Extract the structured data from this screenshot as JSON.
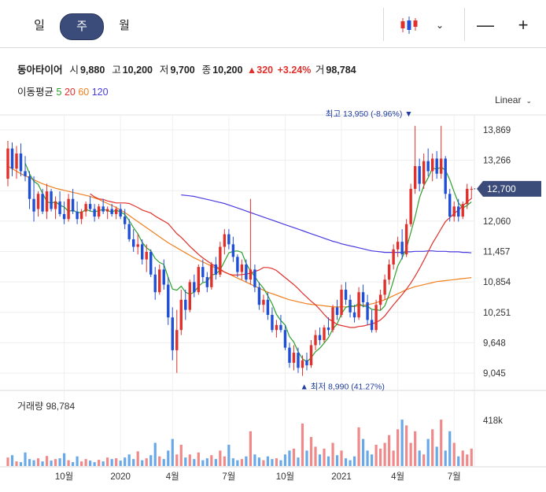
{
  "periods": [
    {
      "label": "일",
      "active": false
    },
    {
      "label": "주",
      "active": true
    },
    {
      "label": "월",
      "active": false
    }
  ],
  "toolbar": {
    "chart_style_icon": "candlestick-icon",
    "dropdown_icon": "chevron-down-icon",
    "zoom_out_icon": "minus-icon",
    "zoom_in_icon": "plus-icon",
    "zoom_out_glyph": "—",
    "zoom_in_glyph": "+"
  },
  "quote": {
    "name": "동아타이어",
    "open_label": "시",
    "open": "9,880",
    "high_label": "고",
    "high": "10,200",
    "low_label": "저",
    "low": "9,700",
    "close_label": "종",
    "close": "10,200",
    "change": "▲320",
    "change_pct": "+3.24%",
    "volume_label": "거",
    "volume": "98,784"
  },
  "moving_average": {
    "label": "이동평균",
    "periods": [
      {
        "value": "5",
        "color": "#2ca02c"
      },
      {
        "value": "20",
        "color": "#e0302c"
      },
      {
        "value": "60",
        "color": "#f07f1e"
      },
      {
        "value": "120",
        "color": "#4a3be0"
      }
    ]
  },
  "scale_button": "Linear",
  "price_panel": {
    "y_ticks": [
      "13,869",
      "13,266",
      "12,663",
      "12,060",
      "11,457",
      "10,854",
      "10,251",
      "9,648",
      "9,045"
    ],
    "current_price": "12,700",
    "high_annotation": "최고 13,950 (-8.96%)",
    "low_annotation": "최저 8,990 (41.27%)"
  },
  "volume_panel": {
    "label": "거래량 98,784",
    "y_tick": "418k"
  },
  "x_ticks": [
    "10월",
    "2020",
    "4월",
    "7월",
    "10월",
    "2021",
    "4월",
    "7월"
  ],
  "colors": {
    "up": "#e0302c",
    "down": "#1f4fd6",
    "vol_up": "#f08a8a",
    "vol_down": "#6aa9e8",
    "ma5": "#2ca02c",
    "ma20": "#e0302c",
    "ma60": "#f07f1e",
    "ma120": "#4a3be0",
    "badge": "#3b4c7b"
  },
  "chart_data": {
    "type": "candlestick",
    "ylim": [
      9045,
      13869
    ],
    "x_ticks": [
      {
        "label": "10월",
        "index": 13
      },
      {
        "label": "2020",
        "index": 26
      },
      {
        "label": "4월",
        "index": 38
      },
      {
        "label": "7월",
        "index": 51
      },
      {
        "label": "10월",
        "index": 64
      },
      {
        "label": "2021",
        "index": 77
      },
      {
        "label": "4월",
        "index": 90
      },
      {
        "label": "7월",
        "index": 103
      }
    ],
    "ohlc": [
      [
        12900,
        13650,
        12750,
        13500
      ],
      [
        13500,
        13620,
        12950,
        13100
      ],
      [
        13100,
        13550,
        12900,
        13400
      ],
      [
        13400,
        13600,
        12950,
        13050
      ],
      [
        13050,
        13350,
        12850,
        12950
      ],
      [
        12950,
        13050,
        12300,
        12500
      ],
      [
        12500,
        12950,
        12050,
        12250
      ],
      [
        12300,
        12650,
        12150,
        12600
      ],
      [
        12600,
        12700,
        12200,
        12250
      ],
      [
        12250,
        12800,
        12100,
        12650
      ],
      [
        12650,
        12700,
        12250,
        12300
      ],
      [
        12300,
        12550,
        12100,
        12450
      ],
      [
        12450,
        12650,
        12150,
        12200
      ],
      [
        12200,
        12450,
        12000,
        12100
      ],
      [
        12100,
        12600,
        12050,
        12500
      ],
      [
        12500,
        12700,
        12200,
        12250
      ],
      [
        12250,
        12450,
        12000,
        12100
      ],
      [
        12100,
        12300,
        12000,
        12250
      ],
      [
        12250,
        12450,
        12150,
        12400
      ],
      [
        12400,
        12550,
        12250,
        12300
      ],
      [
        12300,
        12400,
        12050,
        12150
      ],
      [
        12150,
        12400,
        12100,
        12350
      ],
      [
        12350,
        12500,
        12200,
        12250
      ],
      [
        12250,
        12350,
        12100,
        12300
      ],
      [
        12300,
        12400,
        12150,
        12200
      ],
      [
        12200,
        12350,
        12100,
        12300
      ],
      [
        12300,
        12400,
        12100,
        12150
      ],
      [
        12150,
        12300,
        11900,
        12000
      ],
      [
        12000,
        12100,
        11650,
        11700
      ],
      [
        11700,
        11900,
        11450,
        11550
      ],
      [
        11550,
        11800,
        11400,
        11600
      ],
      [
        11600,
        11700,
        11200,
        11300
      ],
      [
        11300,
        11600,
        11050,
        11450
      ],
      [
        11450,
        11500,
        10950,
        11000
      ],
      [
        11000,
        11150,
        10500,
        10650
      ],
      [
        10650,
        11200,
        10600,
        11100
      ],
      [
        11100,
        11300,
        10700,
        10800
      ],
      [
        10800,
        10950,
        10000,
        10150
      ],
      [
        10150,
        10350,
        9300,
        9500
      ],
      [
        9500,
        10300,
        9050,
        9900
      ],
      [
        9900,
        10700,
        9800,
        10500
      ],
      [
        10500,
        10700,
        10100,
        10300
      ],
      [
        10300,
        10900,
        10250,
        10850
      ],
      [
        10850,
        11000,
        10550,
        10650
      ],
      [
        10650,
        11200,
        10600,
        11150
      ],
      [
        11150,
        11300,
        10850,
        10950
      ],
      [
        10950,
        11050,
        10650,
        10750
      ],
      [
        10750,
        11250,
        10700,
        11200
      ],
      [
        11200,
        11350,
        10900,
        11000
      ],
      [
        11000,
        11650,
        10950,
        11550
      ],
      [
        11550,
        11900,
        11400,
        11800
      ],
      [
        11800,
        11900,
        11500,
        11600
      ],
      [
        11600,
        11750,
        11250,
        11350
      ],
      [
        11350,
        11400,
        10950,
        11050
      ],
      [
        11050,
        11300,
        10900,
        11200
      ],
      [
        11200,
        11300,
        10850,
        10900
      ],
      [
        10900,
        12500,
        10800,
        11100
      ],
      [
        11100,
        11200,
        10650,
        10750
      ],
      [
        10750,
        10850,
        10300,
        10400
      ],
      [
        10400,
        10600,
        10250,
        10500
      ],
      [
        10500,
        10650,
        10100,
        10200
      ],
      [
        10200,
        10350,
        9850,
        9900
      ],
      [
        9900,
        10100,
        9750,
        10000
      ],
      [
        10000,
        10200,
        9850,
        9900
      ],
      [
        9900,
        10000,
        9500,
        9550
      ],
      [
        9550,
        9650,
        9150,
        9250
      ],
      [
        9250,
        9600,
        9100,
        9450
      ],
      [
        9450,
        9550,
        9050,
        9150
      ],
      [
        9150,
        9400,
        8990,
        9300
      ],
      [
        9300,
        9450,
        9100,
        9200
      ],
      [
        9200,
        9700,
        9150,
        9600
      ],
      [
        9600,
        9900,
        9500,
        9800
      ],
      [
        9800,
        9950,
        9600,
        9700
      ],
      [
        9700,
        10000,
        9650,
        9950
      ],
      [
        9950,
        10150,
        9800,
        9900
      ],
      [
        9900,
        10400,
        9850,
        10350
      ],
      [
        10350,
        10500,
        10100,
        10200
      ],
      [
        10200,
        10800,
        10150,
        10700
      ],
      [
        10700,
        10850,
        10400,
        10500
      ],
      [
        10500,
        10600,
        10150,
        10250
      ],
      [
        10250,
        10400,
        10050,
        10150
      ],
      [
        10150,
        10750,
        10100,
        10650
      ],
      [
        10650,
        10800,
        10350,
        10450
      ],
      [
        10450,
        10600,
        10000,
        10100
      ],
      [
        10100,
        10300,
        9850,
        9900
      ],
      [
        9900,
        10500,
        9850,
        10400
      ],
      [
        10400,
        10700,
        10300,
        10600
      ],
      [
        10600,
        11000,
        10500,
        10900
      ],
      [
        10900,
        11300,
        10800,
        11200
      ],
      [
        11200,
        11600,
        11100,
        11500
      ],
      [
        11500,
        11750,
        11350,
        11650
      ],
      [
        11650,
        11900,
        11300,
        11400
      ],
      [
        11400,
        12100,
        11350,
        12000
      ],
      [
        12000,
        12800,
        11950,
        12700
      ],
      [
        12700,
        13950,
        12600,
        13150
      ],
      [
        13150,
        13300,
        12650,
        12800
      ],
      [
        12800,
        13400,
        12700,
        13250
      ],
      [
        13250,
        13500,
        12950,
        13050
      ],
      [
        13050,
        13400,
        12850,
        13300
      ],
      [
        13300,
        13450,
        12900,
        13000
      ],
      [
        13000,
        13950,
        12900,
        13300
      ],
      [
        13300,
        13350,
        12500,
        12600
      ],
      [
        12600,
        12700,
        12050,
        12150
      ],
      [
        12150,
        12450,
        12050,
        12350
      ],
      [
        12350,
        12500,
        12050,
        12150
      ],
      [
        12150,
        12450,
        12100,
        12400
      ],
      [
        12400,
        12800,
        12300,
        12700
      ],
      [
        12700,
        12750,
        12500,
        12700
      ]
    ],
    "ma5": [
      null,
      null,
      null,
      null,
      13210,
      13000,
      12850,
      12790,
      12610,
      12450,
      12410,
      12450,
      12370,
      12340,
      12250,
      12280,
      12230,
      12230,
      12290,
      12260,
      12240,
      12270,
      12290,
      12270,
      12240,
      12280,
      12240,
      12190,
      12070,
      11930,
      11810,
      11640,
      11530,
      11470,
      11320,
      11240,
      11200,
      10940,
      10710,
      10690,
      10770,
      10650,
      10610,
      10650,
      10770,
      10840,
      10860,
      10990,
      11010,
      11090,
      11260,
      11430,
      11460,
      11470,
      11440,
      11220,
      11070,
      10960,
      10830,
      10730,
      10580,
      10420,
      10210,
      10090,
      10000,
      9770,
      9660,
      9470,
      9330,
      9270,
      9350,
      9470,
      9540,
      9640,
      9750,
      9920,
      10020,
      10220,
      10350,
      10380,
      10370,
      10430,
      10370,
      10370,
      10310,
      10300,
      10290,
      10380,
      10600,
      10880,
      11170,
      11330,
      11520,
      11830,
      12150,
      12520,
      12760,
      12920,
      13110,
      13090,
      13130,
      13070,
      12880,
      12640,
      12420,
      12320,
      12370,
      12440
    ],
    "ma20": [
      null,
      null,
      null,
      null,
      null,
      null,
      null,
      null,
      null,
      null,
      null,
      null,
      null,
      null,
      null,
      null,
      null,
      null,
      null,
      12600,
      12540,
      12500,
      12490,
      12460,
      12440,
      12420,
      12420,
      12420,
      12410,
      12370,
      12330,
      12280,
      12250,
      12220,
      12160,
      12110,
      12060,
      12010,
      11910,
      11810,
      11740,
      11650,
      11560,
      11480,
      11400,
      11330,
      11270,
      11210,
      11160,
      11110,
      11050,
      11010,
      10990,
      10990,
      11000,
      11010,
      11030,
      11060,
      11090,
      11140,
      11140,
      11120,
      11080,
      11010,
      10940,
      10870,
      10800,
      10720,
      10630,
      10550,
      10470,
      10400,
      10310,
      10210,
      10120,
      10070,
      10010,
      9990,
      9970,
      9950,
      9950,
      9970,
      9980,
      10000,
      10020,
      10050,
      10100,
      10180,
      10290,
      10400,
      10500,
      10600,
      10710,
      10830,
      10970,
      11120,
      11280,
      11450,
      11620,
      11760,
      11910,
      12050,
      12130,
      12210,
      12280,
      12360,
      12440,
      12510
    ],
    "ma60": [
      13150,
      13100,
      13050,
      13000,
      12960,
      12920,
      12880,
      12840,
      12800,
      12770,
      12740,
      12710,
      12690,
      12670,
      12650,
      12630,
      12610,
      12590,
      12570,
      12550,
      12520,
      12490,
      12450,
      12410,
      12370,
      12330,
      12280,
      12230,
      12170,
      12110,
      12050,
      11990,
      11930,
      11870,
      11810,
      11750,
      11690,
      11630,
      11580,
      11530,
      11480,
      11430,
      11380,
      11330,
      11290,
      11250,
      11210,
      11170,
      11130,
      11090,
      11050,
      11010,
      10970,
      10930,
      10890,
      10850,
      10810,
      10770,
      10730,
      10690,
      10650,
      10620,
      10590,
      10560,
      10530,
      10500,
      10480,
      10460,
      10440,
      10420,
      10410,
      10400,
      10390,
      10380,
      10370,
      10360,
      10360,
      10360,
      10360,
      10360,
      10370,
      10380,
      10390,
      10400,
      10420,
      10440,
      10470,
      10500,
      10540,
      10580,
      10620,
      10660,
      10700,
      10730,
      10760,
      10780,
      10800,
      10820,
      10840,
      10860,
      10870,
      10880,
      10890,
      10900,
      10910,
      10920,
      10930,
      10940
    ],
    "ma120": [
      null,
      null,
      null,
      null,
      null,
      null,
      null,
      null,
      null,
      null,
      null,
      null,
      null,
      null,
      null,
      null,
      null,
      null,
      null,
      null,
      null,
      null,
      null,
      null,
      null,
      null,
      null,
      null,
      null,
      null,
      null,
      null,
      null,
      null,
      null,
      null,
      null,
      null,
      null,
      null,
      12580,
      12570,
      12560,
      12550,
      12530,
      12510,
      12490,
      12470,
      12450,
      12430,
      12410,
      12380,
      12350,
      12320,
      12290,
      12260,
      12230,
      12200,
      12170,
      12140,
      12110,
      12080,
      12050,
      12020,
      11990,
      11960,
      11930,
      11900,
      11870,
      11840,
      11810,
      11780,
      11750,
      11720,
      11690,
      11660,
      11640,
      11610,
      11590,
      11570,
      11550,
      11530,
      11510,
      11490,
      11470,
      11460,
      11450,
      11440,
      11440,
      11440,
      11440,
      11440,
      11450,
      11450,
      11460,
      11460,
      11460,
      11470,
      11470,
      11460,
      11460,
      11460,
      11450,
      11450,
      11450,
      11440,
      11440,
      11430
    ],
    "volume": [
      22,
      28,
      12,
      10,
      35,
      18,
      15,
      20,
      12,
      26,
      14,
      18,
      20,
      33,
      15,
      10,
      25,
      12,
      18,
      14,
      10,
      16,
      12,
      22,
      18,
      20,
      14,
      22,
      30,
      18,
      38,
      15,
      20,
      28,
      60,
      25,
      18,
      40,
      70,
      30,
      55,
      22,
      30,
      18,
      35,
      15,
      20,
      28,
      18,
      40,
      25,
      55,
      20,
      15,
      18,
      25,
      90,
      30,
      22,
      15,
      25,
      18,
      20,
      15,
      30,
      40,
      45,
      22,
      110,
      40,
      75,
      50,
      30,
      45,
      25,
      60,
      28,
      40,
      20,
      15,
      25,
      100,
      70,
      40,
      30,
      55,
      45,
      60,
      80,
      40,
      95,
      120,
      105,
      60,
      90,
      40,
      30,
      70,
      95,
      50,
      120,
      40,
      90,
      60,
      25,
      40,
      30,
      45
    ],
    "volume_ylim": [
      0,
      175
    ]
  }
}
